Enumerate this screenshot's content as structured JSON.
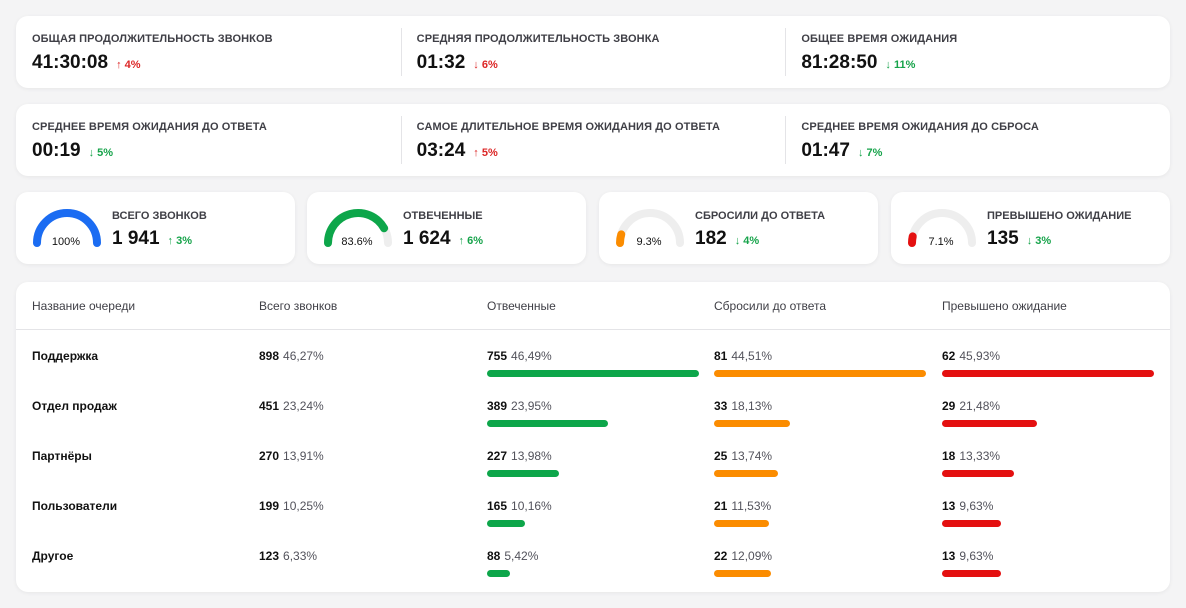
{
  "colors": {
    "green": "#0da64a",
    "orange": "#fb8c00",
    "red": "#e41010",
    "blue": "#1b6cf2",
    "track": "#eeeeee",
    "delta_up": "#dc2626",
    "delta_down": "#16a34a"
  },
  "stats_row1": [
    {
      "label": "ОБЩАЯ ПРОДОЛЖИТЕЛЬНОСТЬ ЗВОНКОВ",
      "value": "41:30:08",
      "delta": "↑ 4%",
      "direction": "up"
    },
    {
      "label": "СРЕДНЯЯ ПРОДОЛЖИТЕЛЬНОСТЬ ЗВОНКА",
      "value": "01:32",
      "delta": "↓ 6%",
      "direction": "up"
    },
    {
      "label": "ОБЩЕЕ ВРЕМЯ ОЖИДАНИЯ",
      "value": "81:28:50",
      "delta": "↓ 11%",
      "direction": "down"
    }
  ],
  "stats_row2": [
    {
      "label": "СРЕДНЕЕ ВРЕМЯ ОЖИДАНИЯ ДО ОТВЕТА",
      "value": "00:19",
      "delta": "↓ 5%",
      "direction": "down"
    },
    {
      "label": "САМОЕ ДЛИТЕЛЬНОЕ ВРЕМЯ ОЖИДАНИЯ ДО ОТВЕТА",
      "value": "03:24",
      "delta": "↑ 5%",
      "direction": "up"
    },
    {
      "label": "СРЕДНЕЕ ВРЕМЯ ОЖИДАНИЯ ДО СБРОСА",
      "value": "01:47",
      "delta": "↓ 7%",
      "direction": "down"
    }
  ],
  "gauges": [
    {
      "label": "ВСЕГО ЗВОНКОВ",
      "value": "1 941",
      "delta": "↑ 3%",
      "percent_text": "100%",
      "fraction": 1.0,
      "color": "#1b6cf2"
    },
    {
      "label": "ОТВЕЧЕННЫЕ",
      "value": "1 624",
      "delta": "↑ 6%",
      "percent_text": "83.6%",
      "fraction": 0.836,
      "color": "#0da64a"
    },
    {
      "label": "СБРОСИЛИ ДО ОТВЕТА",
      "value": "182",
      "delta": "↓ 4%",
      "percent_text": "9.3%",
      "fraction": 0.093,
      "color": "#fb8c00"
    },
    {
      "label": "ПРЕВЫШЕНО ОЖИДАНИЕ",
      "value": "135",
      "delta": "↓ 3%",
      "percent_text": "7.1%",
      "fraction": 0.071,
      "color": "#e41010"
    }
  ],
  "table": {
    "headers": [
      "Название очереди",
      "Всего звонков",
      "Отвеченные",
      "Сбросили до ответа",
      "Превышено ожидание"
    ],
    "rows": [
      {
        "name": "Поддержка",
        "total": {
          "num": "898",
          "pct": "46,27%"
        },
        "answered": {
          "num": "755",
          "pct": "46,49%",
          "bar": 1.0
        },
        "dropped": {
          "num": "81",
          "pct": "44,51%",
          "bar": 1.0
        },
        "exceeded": {
          "num": "62",
          "pct": "45,93%",
          "bar": 1.0
        }
      },
      {
        "name": "Отдел продаж",
        "total": {
          "num": "451",
          "pct": "23,24%"
        },
        "answered": {
          "num": "389",
          "pct": "23,95%",
          "bar": 0.57
        },
        "dropped": {
          "num": "33",
          "pct": "18,13%",
          "bar": 0.36
        },
        "exceeded": {
          "num": "29",
          "pct": "21,48%",
          "bar": 0.45
        }
      },
      {
        "name": "Партнёры",
        "total": {
          "num": "270",
          "pct": "13,91%"
        },
        "answered": {
          "num": "227",
          "pct": "13,98%",
          "bar": 0.34
        },
        "dropped": {
          "num": "25",
          "pct": "13,74%",
          "bar": 0.3
        },
        "exceeded": {
          "num": "18",
          "pct": "13,33%",
          "bar": 0.34
        }
      },
      {
        "name": "Пользователи",
        "total": {
          "num": "199",
          "pct": "10,25%"
        },
        "answered": {
          "num": "165",
          "pct": "10,16%",
          "bar": 0.18
        },
        "dropped": {
          "num": "21",
          "pct": "11,53%",
          "bar": 0.26
        },
        "exceeded": {
          "num": "13",
          "pct": "9,63%",
          "bar": 0.28
        }
      },
      {
        "name": "Другое",
        "total": {
          "num": "123",
          "pct": "6,33%"
        },
        "answered": {
          "num": "88",
          "pct": "5,42%",
          "bar": 0.11
        },
        "dropped": {
          "num": "22",
          "pct": "12,09%",
          "bar": 0.27
        },
        "exceeded": {
          "num": "13",
          "pct": "9,63%",
          "bar": 0.28
        }
      }
    ]
  }
}
